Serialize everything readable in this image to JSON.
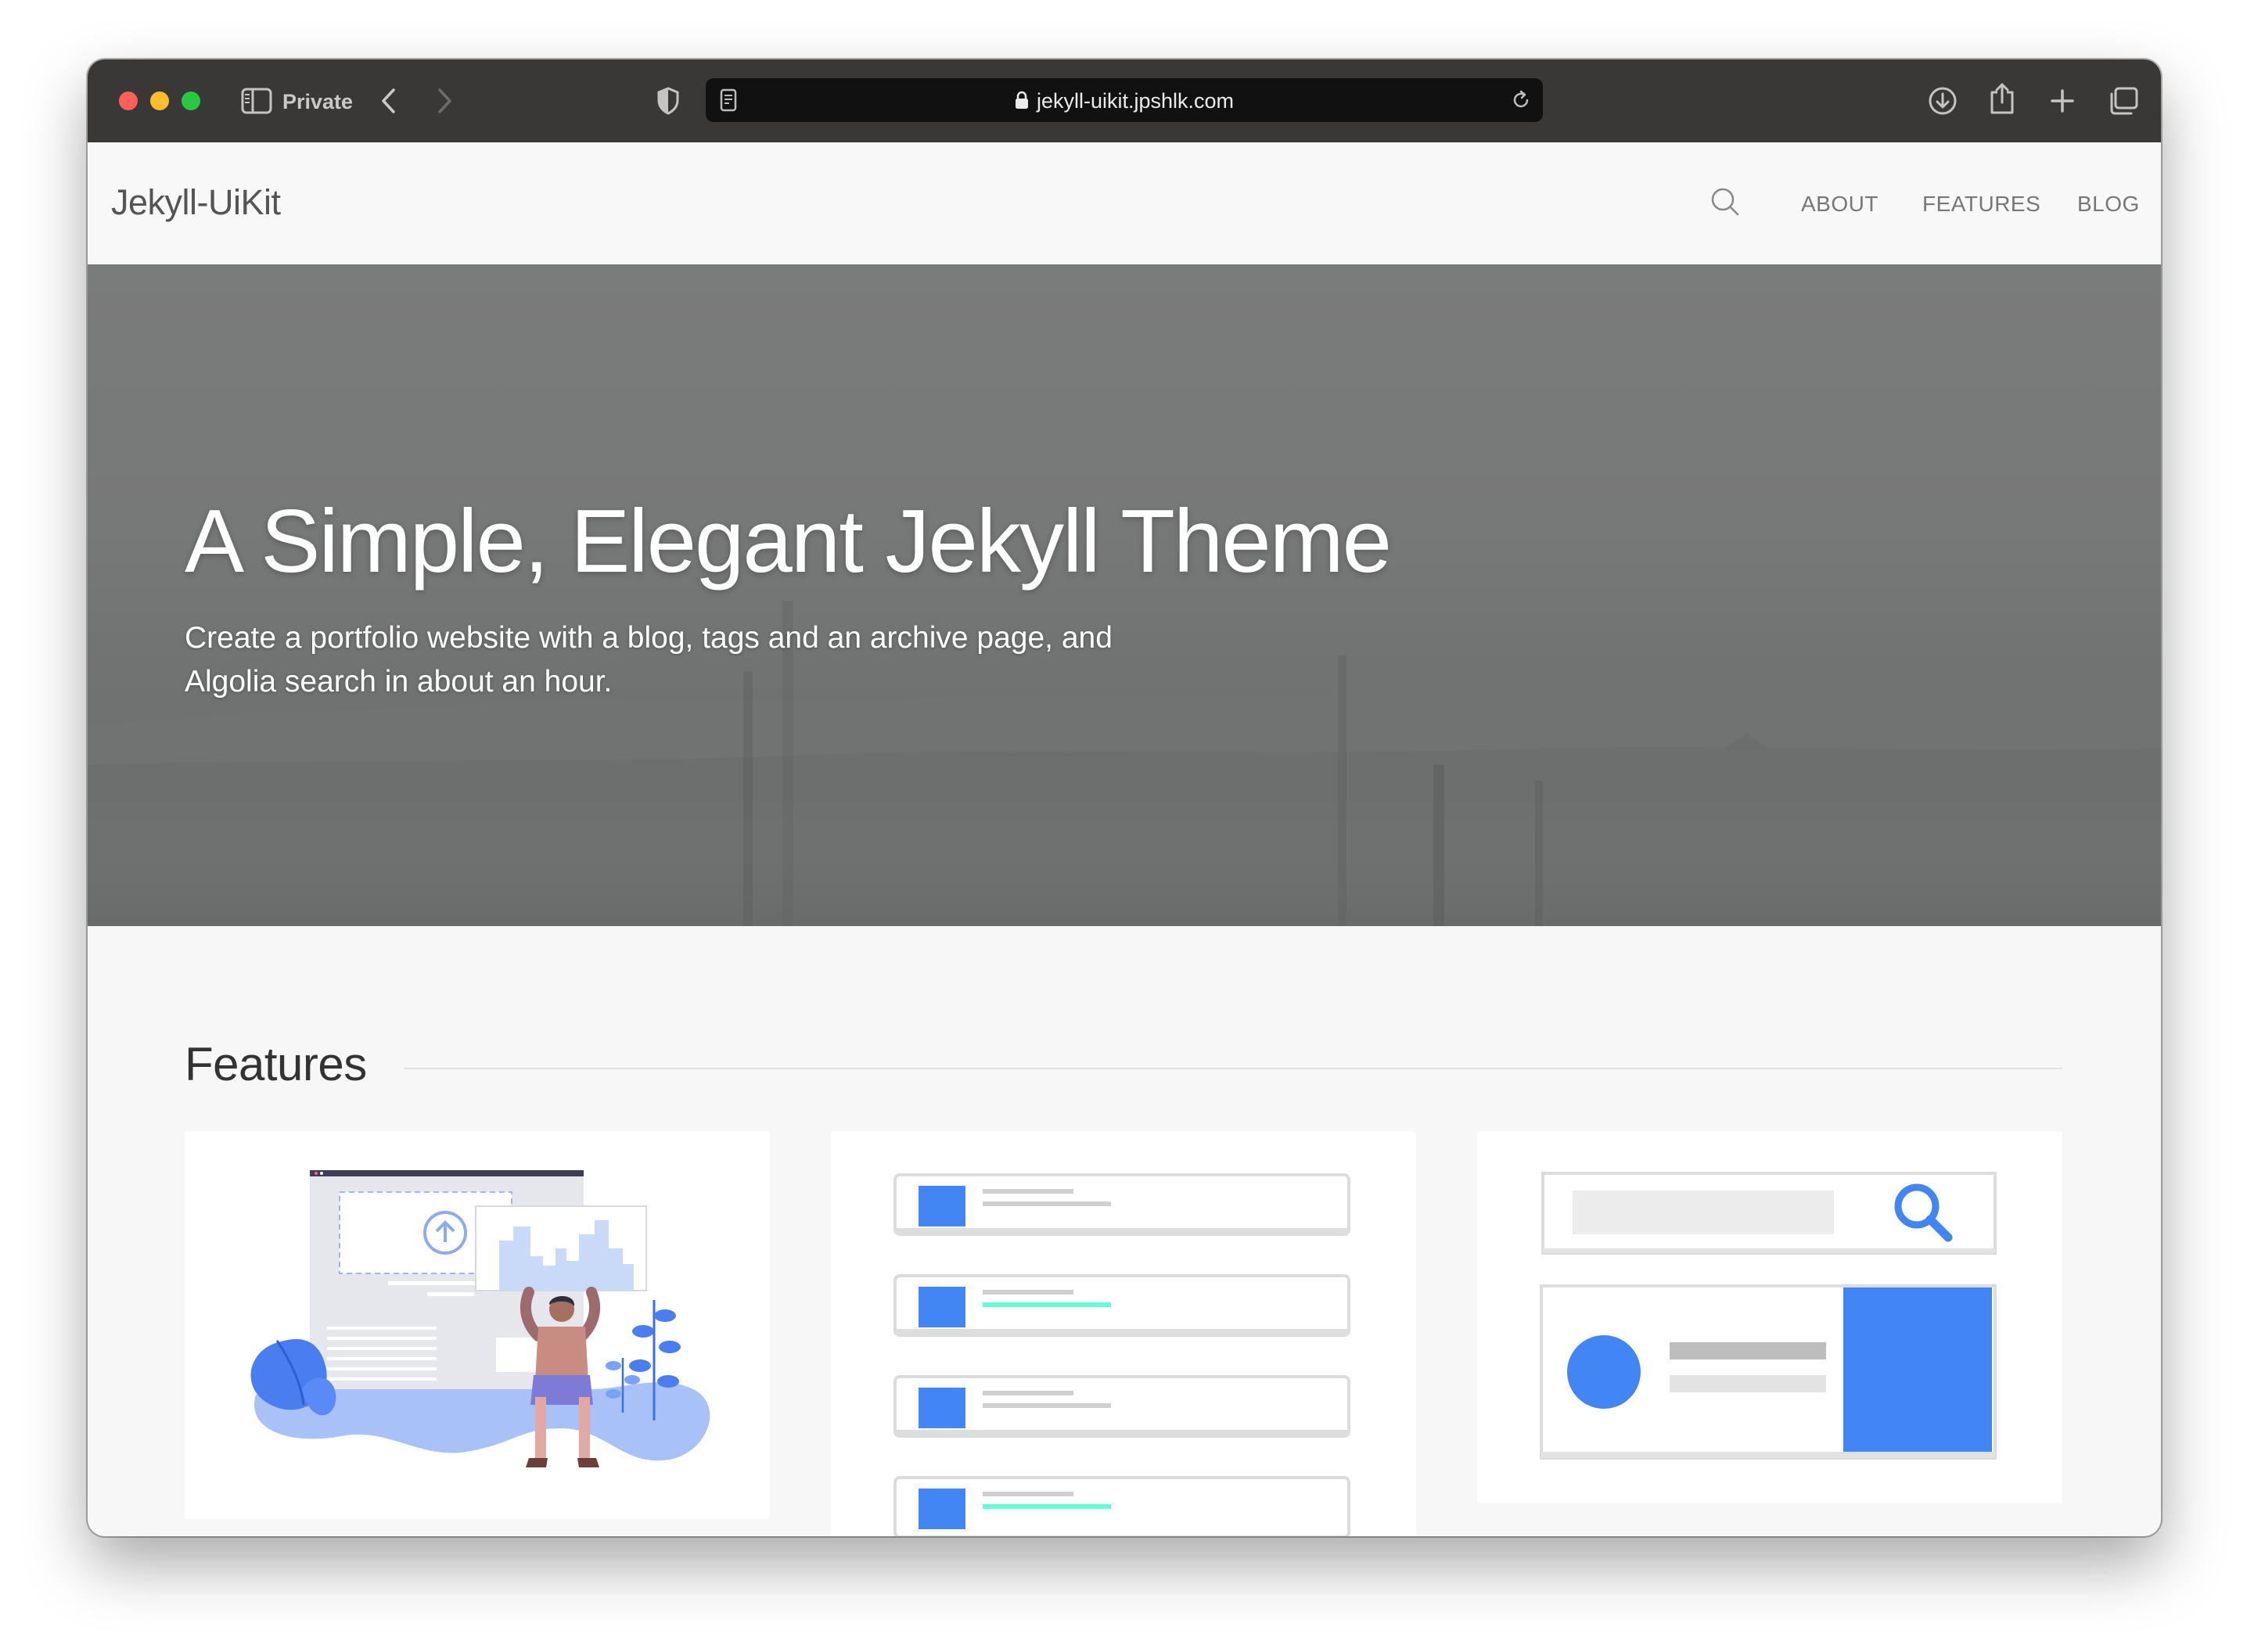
{
  "browser": {
    "private_label": "Private",
    "url": "jekyll-uikit.jpshlk.com",
    "icons": [
      "sidebar-icon",
      "back-icon",
      "forward-icon",
      "shield-icon",
      "reader-icon",
      "lock-icon",
      "reload-icon",
      "download-icon",
      "share-icon",
      "new-tab-icon",
      "tabs-overview-icon"
    ]
  },
  "site": {
    "brand": "Jekyll-UiKit",
    "nav": {
      "about": "ABOUT",
      "features": "FEATURES",
      "blog": "BLOG"
    }
  },
  "hero": {
    "title": "A Simple, Elegant Jekyll Theme",
    "subtitle": "Create a portfolio website with a blog, tags and an archive page, and Algolia search in about an hour."
  },
  "features": {
    "heading": "Features",
    "cards": [
      {
        "illustration": "upload-illustration"
      },
      {
        "illustration": "list-items-illustration"
      },
      {
        "illustration": "search-card-illustration"
      }
    ]
  },
  "colors": {
    "accent_blue": "#4285f4",
    "accent_teal": "#64ffda",
    "toolbar_bg": "#393837",
    "hero_bg": "#777878"
  }
}
